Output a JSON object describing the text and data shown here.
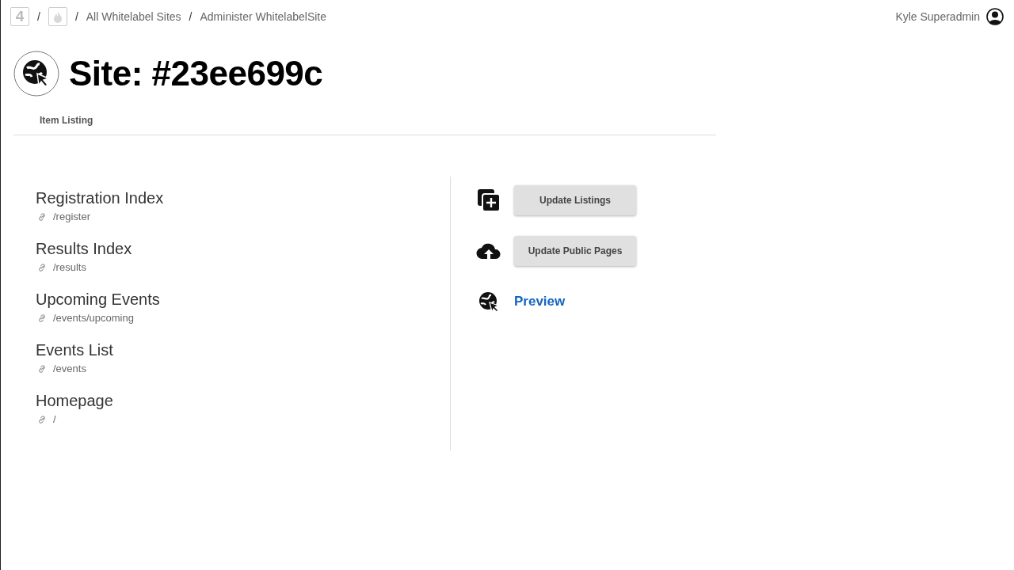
{
  "breadcrumb": {
    "logo": "4",
    "items": [
      "All Whitelabel Sites",
      "Administer WhitelabelSite"
    ],
    "separator": "/"
  },
  "user": {
    "name": "Kyle Superadmin"
  },
  "title": "Site: #23ee699c",
  "tabs": [
    {
      "label": "Item Listing"
    }
  ],
  "pages": [
    {
      "name": "Registration Index",
      "path": "/register"
    },
    {
      "name": "Results Index",
      "path": "/results"
    },
    {
      "name": "Upcoming Events",
      "path": "/events/upcoming"
    },
    {
      "name": "Events List",
      "path": "/events"
    },
    {
      "name": "Homepage",
      "path": "/"
    }
  ],
  "actions": [
    {
      "kind": "button",
      "label": "Update Listings"
    },
    {
      "kind": "button",
      "label": "Update Public Pages"
    },
    {
      "kind": "link",
      "label": "Preview"
    }
  ]
}
